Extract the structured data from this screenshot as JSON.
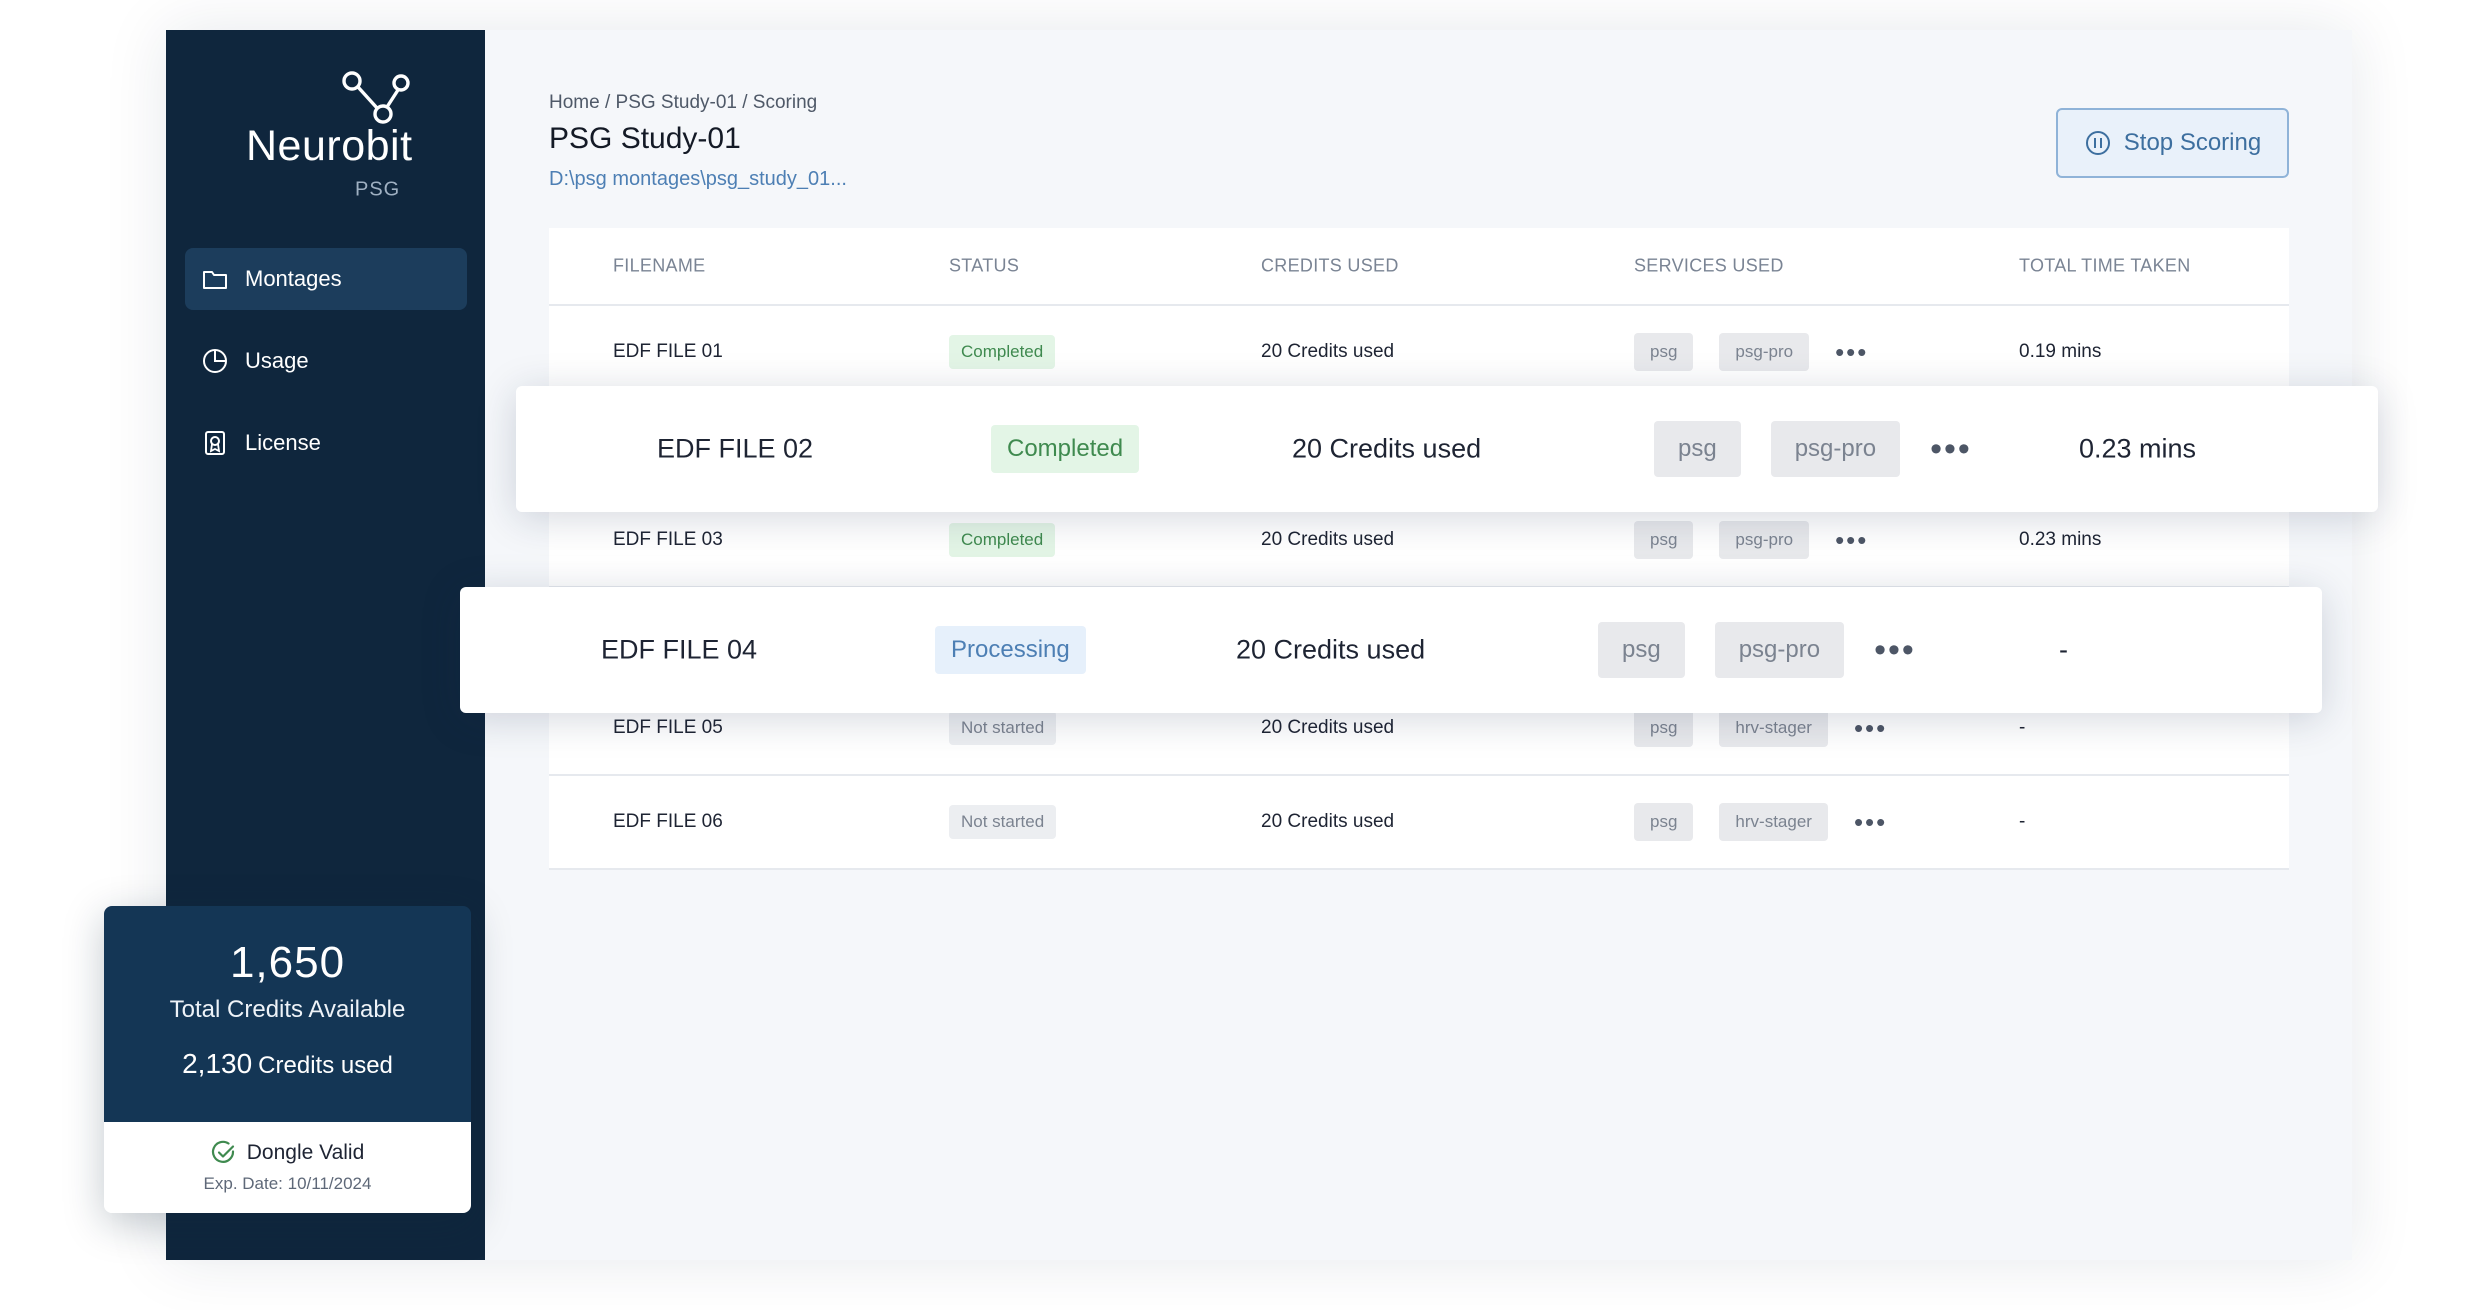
{
  "brand": {
    "name": "Neurobit",
    "sub": "PSG"
  },
  "sidebar": {
    "items": [
      {
        "label": "Montages",
        "icon": "folder-icon",
        "active": true
      },
      {
        "label": "Usage",
        "icon": "pie-chart-icon",
        "active": false
      },
      {
        "label": "License",
        "icon": "license-icon",
        "active": false
      }
    ]
  },
  "credits": {
    "total": "1,650",
    "total_label": "Total Credits Available",
    "used": "2,130",
    "used_label": "Credits used",
    "dongle": "Dongle Valid",
    "exp": "Exp. Date: 10/11/2024"
  },
  "header": {
    "breadcrumb": "Home / PSG Study-01 / Scoring",
    "title": "PSG Study-01",
    "path": "D:\\psg montages\\psg_study_01...",
    "stop_label": "Stop Scoring"
  },
  "table": {
    "columns": [
      "FILENAME",
      "STATUS",
      "CREDITS USED",
      "SERVICES USED",
      "TOTAL TIME TAKEN"
    ],
    "rows": [
      {
        "file": "EDF FILE 01",
        "status": "Completed",
        "credits": "20 Credits used",
        "services": [
          "psg",
          "psg-pro"
        ],
        "time": "0.19 mins"
      },
      {
        "file": "EDF FILE 02",
        "status": "Completed",
        "credits": "20 Credits used",
        "services": [
          "psg",
          "psg-pro"
        ],
        "time": "0.23 mins"
      },
      {
        "file": "EDF FILE 03",
        "status": "Completed",
        "credits": "20 Credits used",
        "services": [
          "psg",
          "psg-pro"
        ],
        "time": "0.23 mins"
      },
      {
        "file": "EDF FILE 04",
        "status": "Processing",
        "credits": "20 Credits used",
        "services": [
          "psg",
          "psg-pro"
        ],
        "time": "-"
      },
      {
        "file": "EDF FILE 05",
        "status": "Not started",
        "credits": "20 Credits used",
        "services": [
          "psg",
          "hrv-stager"
        ],
        "time": "-"
      },
      {
        "file": "EDF FILE 06",
        "status": "Not started",
        "credits": "20 Credits used",
        "services": [
          "psg",
          "hrv-stager"
        ],
        "time": "-"
      }
    ],
    "more_glyph": "•••"
  },
  "colors": {
    "sidebar_bg": "#0f263d",
    "card_bg": "#143655",
    "accent": "#4d7fb4",
    "completed": "#3f8a4f"
  }
}
